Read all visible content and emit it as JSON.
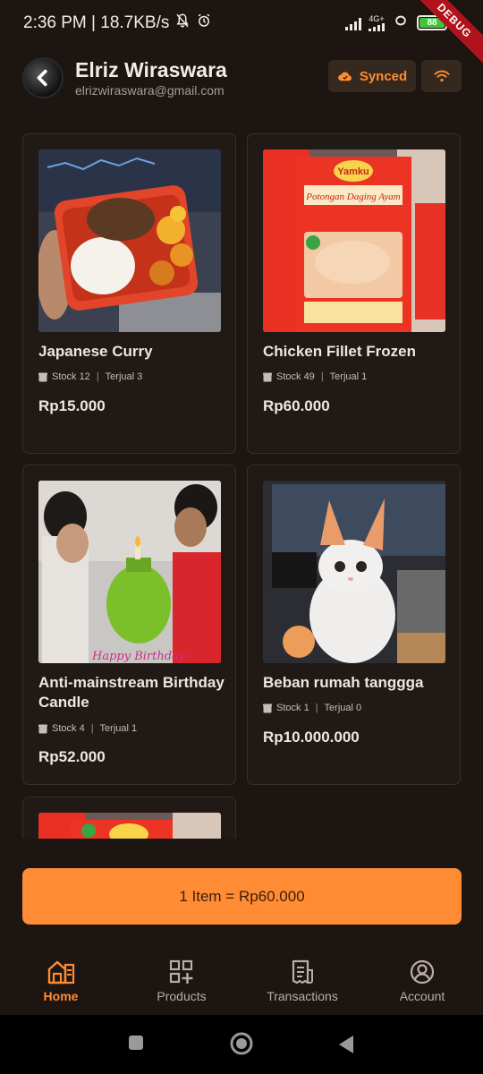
{
  "status_bar": {
    "time_speed": "2:36 PM | 18.7KB/s",
    "network": "4G+",
    "battery": "88",
    "debug_label": "DEBUG"
  },
  "header": {
    "user_name": "Elriz Wiraswara",
    "user_email": "elrizwiraswara@gmail.com",
    "synced_label": "Synced"
  },
  "products": [
    {
      "name": "Japanese Curry",
      "stock": "Stock 12",
      "sold": "Terjual 3",
      "price": "Rp15.000"
    },
    {
      "name": "Chicken Fillet Frozen",
      "stock": "Stock 49",
      "sold": "Terjual 1",
      "price": "Rp60.000",
      "package_brand": "Yamku",
      "package_text": "Potongan Daging Ayam"
    },
    {
      "name": "Anti-mainstream Birthday Candle",
      "stock": "Stock 4",
      "sold": "Terjual 1",
      "price": "Rp52.000",
      "image_caption": "Happy Birthday"
    },
    {
      "name": "Beban rumah tanggga",
      "stock": "Stock 1",
      "sold": "Terjual 0",
      "price": "Rp10.000.000"
    }
  ],
  "cart_summary": "1 Item = Rp60.000",
  "nav": {
    "home": "Home",
    "products": "Products",
    "transactions": "Transactions",
    "account": "Account"
  },
  "colors": {
    "accent": "#ff8c35",
    "background": "#1d1511",
    "card": "#211915"
  }
}
